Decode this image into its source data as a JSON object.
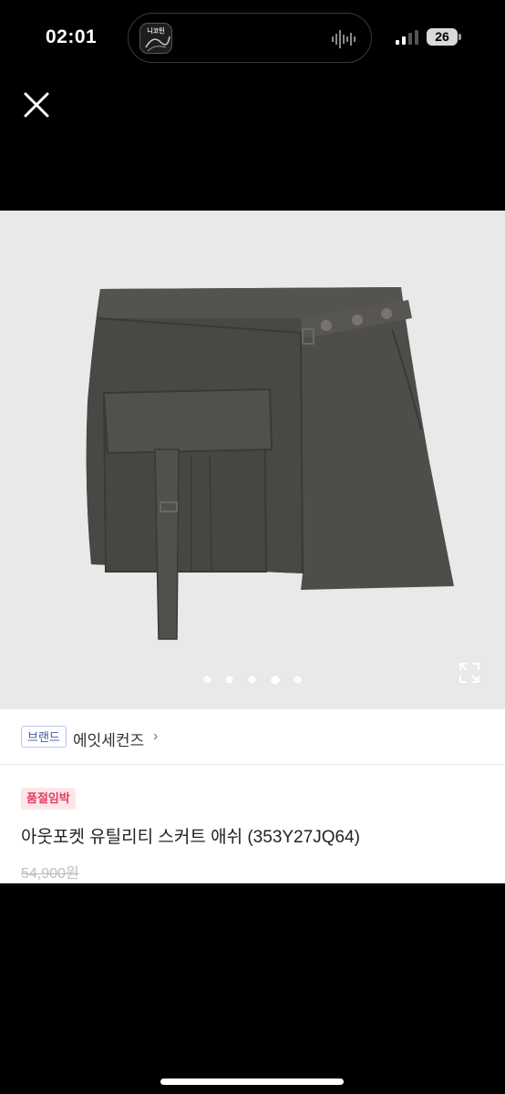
{
  "status_bar": {
    "time": "02:01",
    "battery": "26",
    "island_thumb_label": "니코틴"
  },
  "close_icon": "close-icon",
  "gallery": {
    "dot_count": 5,
    "active_index": 3,
    "expand_icon": "expand-icon"
  },
  "brand": {
    "tag": "브랜드",
    "name": "에잇세컨즈",
    "arrow": "›"
  },
  "product": {
    "badge": "품절임박",
    "title": "아웃포켓 유틸리티 스커트  애쉬 (353Y27JQ64)",
    "old_price": "54,900원"
  },
  "colors": {
    "brand_tag_border": "#b7c3ea",
    "brand_tag_text": "#3c5aa8",
    "badge_bg": "#fde6ea",
    "badge_text": "#e23c5f"
  }
}
